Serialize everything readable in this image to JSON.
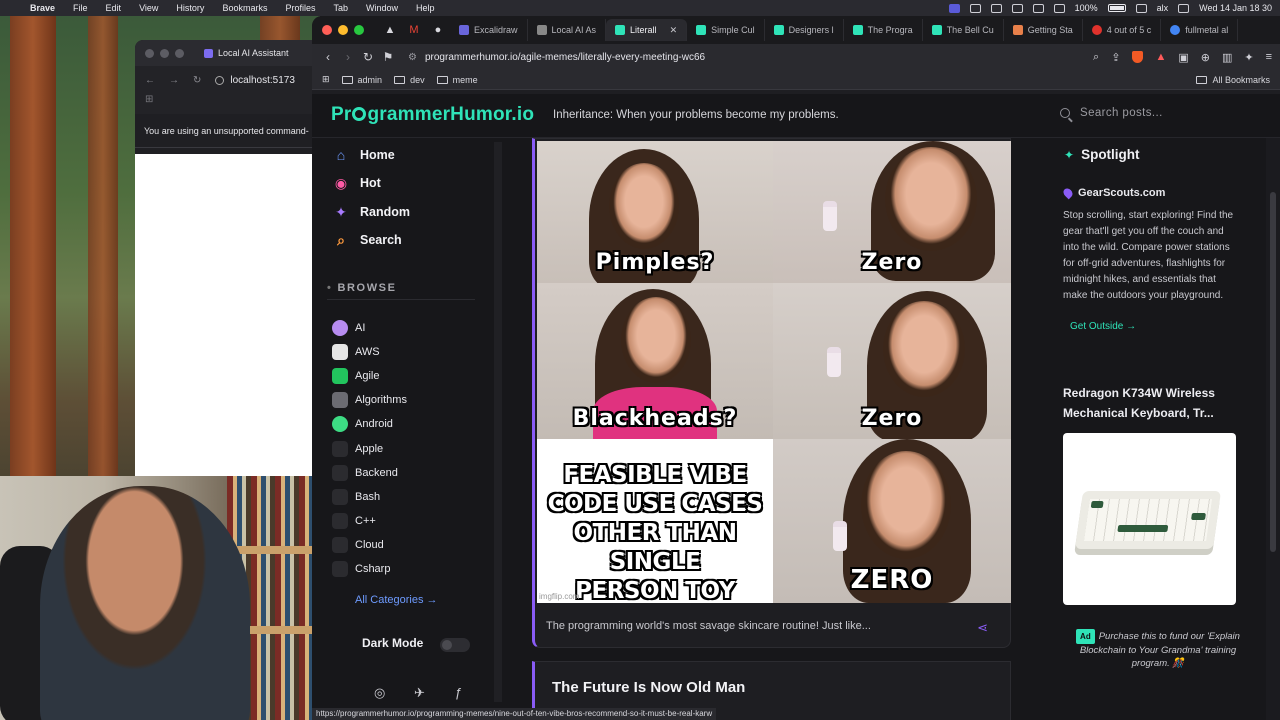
{
  "menubar": {
    "app": "Brave",
    "items": [
      "File",
      "Edit",
      "View",
      "History",
      "Bookmarks",
      "Profiles",
      "Tab",
      "Window",
      "Help"
    ],
    "battery": "100%",
    "user": "alx",
    "datetime": "Wed 14 Jan  18 30"
  },
  "second_window": {
    "tab_title": "Local AI Assistant",
    "url": "localhost:5173",
    "notice": "You are using an unsupported command-"
  },
  "browser": {
    "tabs": [
      {
        "title": "Excalidraw",
        "color": "#6965db"
      },
      {
        "title": "Local AI As",
        "color": "#888888"
      },
      {
        "title": "Literall",
        "color": "#2fe3b8",
        "active": true
      },
      {
        "title": "Simple Cul",
        "color": "#2fe3b8"
      },
      {
        "title": "Designers l",
        "color": "#2fe3b8"
      },
      {
        "title": "The Progra",
        "color": "#2fe3b8"
      },
      {
        "title": "The Bell Cu",
        "color": "#2fe3b8"
      },
      {
        "title": "Getting Sta",
        "color": "#e8804a"
      },
      {
        "title": "4 out of 5 c",
        "color": "#e0322c"
      },
      {
        "title": "fullmetal al",
        "color": "#4285f4"
      }
    ],
    "url": "programmerhumor.io/agile-memes/literally-every-meeting-wc66",
    "bookmarks": [
      "admin",
      "dev",
      "meme"
    ],
    "all_bookmarks": "All Bookmarks",
    "shield_count": "1"
  },
  "site": {
    "logo_pre": "Pr",
    "logo_post": "grammerHumor.io",
    "tagline": "Inheritance: When your problems become my problems.",
    "search_placeholder": "Search posts...",
    "nav": [
      {
        "label": "Home",
        "icon": "home-icon",
        "color": "#6e9bff"
      },
      {
        "label": "Hot",
        "icon": "flame-icon",
        "color": "#ff5aa5"
      },
      {
        "label": "Random",
        "icon": "sparkle-icon",
        "color": "#a87bff"
      },
      {
        "label": "Search",
        "icon": "search-icon",
        "color": "#ff9a3d"
      }
    ],
    "browse_title": "BROWSE",
    "categories": [
      {
        "label": "AI",
        "color": "#b78cf0"
      },
      {
        "label": "AWS",
        "color": "#e5e5e5"
      },
      {
        "label": "Agile",
        "color": "#22c55e"
      },
      {
        "label": "Algorithms",
        "color": "#6b6b72"
      },
      {
        "label": "Android",
        "color": "#3ddc84"
      },
      {
        "label": "Apple",
        "color": "#2b2b2f"
      },
      {
        "label": "Backend",
        "color": "#ef4444"
      },
      {
        "label": "Bash",
        "color": "#2b2b2f"
      },
      {
        "label": "C++",
        "color": "#2b2b2f"
      },
      {
        "label": "Cloud",
        "color": "#2b2b2f"
      },
      {
        "label": "Csharp",
        "color": "#2b2b2f"
      }
    ],
    "all_categories": "All Categories →",
    "dark_mode": "Dark Mode"
  },
  "post": {
    "meme_captions": [
      "Pimples?",
      "Zero",
      "Blackheads?",
      "Zero",
      "FEASIBLE VIBE CODE USE CASES OTHER THAN SINGLE PERSON TOY PROJECTS",
      "ZERO"
    ],
    "watermark": "imgflip.com",
    "caption": "The programming world's most savage skincare routine! Just like...",
    "next_title": "The Future Is Now Old Man"
  },
  "rightcol": {
    "spotlight": "Spotlight",
    "sponsor": "GearScouts.com",
    "sponsor_desc": "Stop scrolling, start exploring! Find the gear that'll get you off the couch and into the wild. Compare power stations for off-grid adventures, flashlights for midnight hikes, and essentials that make the outdoors your playground.",
    "sponsor_link": "Get Outside →",
    "product_title": "Redragon K734W Wireless Mechanical Keyboard, Tr...",
    "ad_badge": "Ad",
    "ad_text": "Purchase this to fund our 'Explain Blockchain to Your Grandma' training program. 🎊"
  },
  "status_url": "https://programmerhumor.io/programming-memes/nine-out-of-ten-vibe-bros-recommend-so-it-must-be-real-karw"
}
